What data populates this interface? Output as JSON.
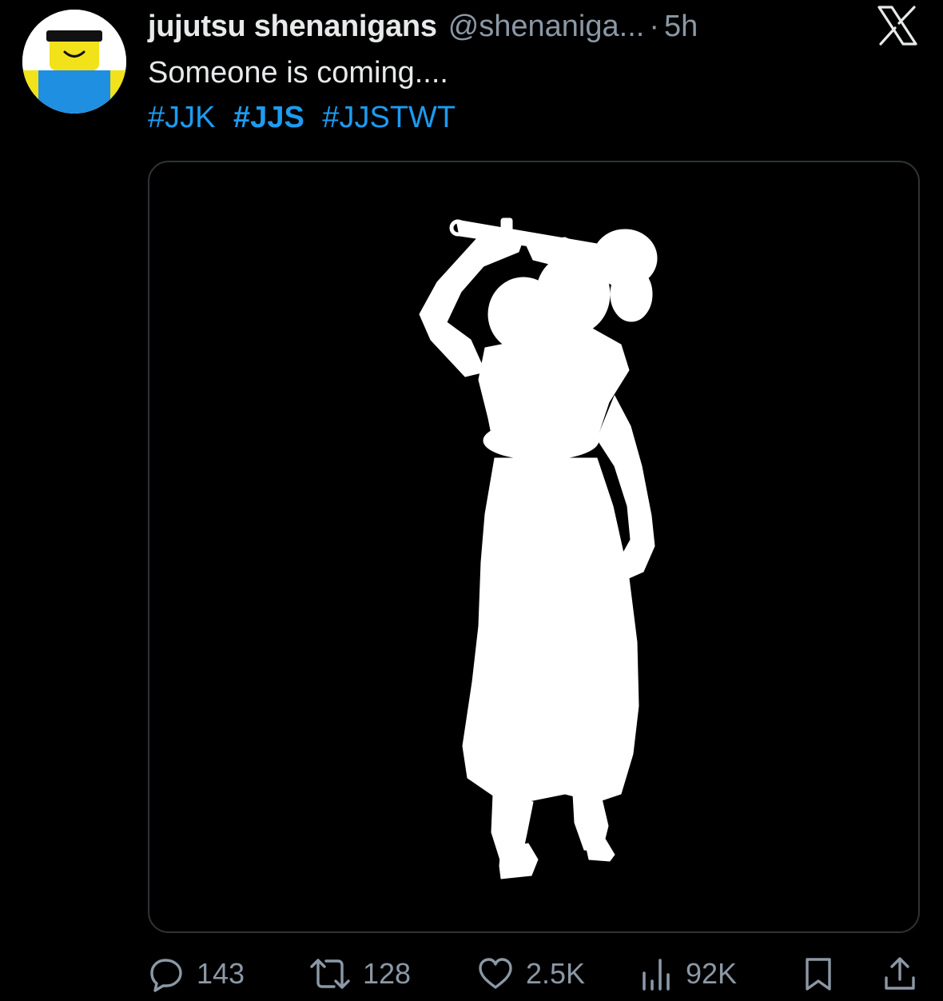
{
  "tweet": {
    "author": {
      "display_name": "jujutsu shenanigans",
      "handle": "@shenaniga...",
      "avatar_icon": "roblox-noob-avatar"
    },
    "separator": "·",
    "time": "5h",
    "text": "Someone is coming....",
    "hashtags": [
      {
        "text": "#JJK",
        "bold": false
      },
      {
        "text": "#JJS",
        "bold": true
      },
      {
        "text": "#JJSTWT",
        "bold": false
      }
    ],
    "media": {
      "icon": "silhouette-figure-with-sword",
      "background": "#000000",
      "figure_color": "#ffffff"
    },
    "actions": {
      "reply": {
        "icon": "reply-icon",
        "count": "143"
      },
      "retweet": {
        "icon": "retweet-icon",
        "count": "128"
      },
      "like": {
        "icon": "heart-icon",
        "count": "2.5K"
      },
      "views": {
        "icon": "views-icon",
        "count": "92K"
      },
      "bookmark": {
        "icon": "bookmark-icon"
      },
      "share": {
        "icon": "share-icon"
      }
    }
  },
  "brand": {
    "logo_icon": "x-logo-icon"
  },
  "colors": {
    "background": "#000000",
    "text": "#e7e9ea",
    "secondary": "#8b98a5",
    "accent": "#1d9bf0",
    "border": "#2f3336"
  }
}
